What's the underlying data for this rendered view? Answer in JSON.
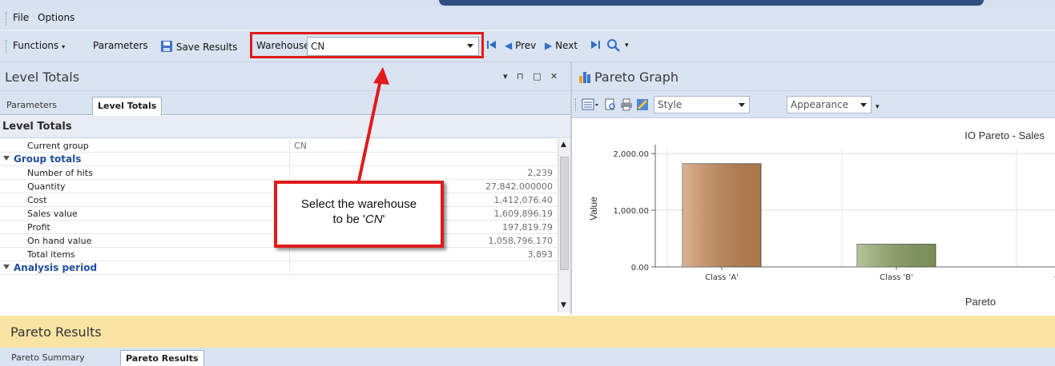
{
  "menu": {
    "file": "File",
    "options": "Options"
  },
  "toolbar": {
    "functions": "Functions",
    "parameters": "Parameters",
    "save_results": "Save Results",
    "warehouse_label": "Warehouse:",
    "warehouse_value": "CN",
    "prev": "Prev",
    "next": "Next"
  },
  "level_totals_panel": {
    "title": "Level Totals",
    "tabs": [
      "Parameters",
      "Level Totals"
    ],
    "active_tab": "Level Totals",
    "section_title": "Level Totals",
    "rows": [
      {
        "label": "Current group",
        "value": "CN"
      },
      {
        "label": "Group totals",
        "value": ""
      },
      {
        "label": "Number of hits",
        "value": "2,239"
      },
      {
        "label": "Quantity",
        "value": "27,842.000000"
      },
      {
        "label": "Cost",
        "value": "1,412,076.40"
      },
      {
        "label": "Sales value",
        "value": "1,609,896.19"
      },
      {
        "label": "Profit",
        "value": "197,819.79"
      },
      {
        "label": "On hand value",
        "value": "1,058,796.170"
      },
      {
        "label": "Total items",
        "value": "3,893"
      },
      {
        "label": "Analysis period",
        "value": ""
      }
    ]
  },
  "callout": {
    "line1": "Select the warehouse",
    "line2_prefix": "to be '",
    "line2_value": "CN",
    "line2_suffix": "'"
  },
  "pareto_graph_panel": {
    "title": "Pareto Graph",
    "style_label": "Style",
    "appearance_label": "Appearance"
  },
  "chart_data": {
    "type": "bar",
    "title": "IO Pareto - Sales",
    "xlabel": "Pareto",
    "ylabel": "Value",
    "categories": [
      "Class 'A'",
      "Class 'B'",
      "Class 'C'"
    ],
    "values": [
      1820,
      400,
      0
    ],
    "ylim": [
      0,
      2100
    ],
    "yticks": [
      0,
      1000,
      2000
    ],
    "ytick_labels": [
      "0.00",
      "1,000.00",
      "2,000.00"
    ],
    "grid": true,
    "colors": [
      "#c98a55",
      "#8fa766",
      "#bbbbbb"
    ]
  },
  "pareto_results_panel": {
    "title": "Pareto Results",
    "tabs": [
      "Pareto Summary",
      "Pareto Results"
    ],
    "active_tab": "Pareto Results"
  },
  "colors": {
    "highlight": "#e01b1b",
    "chrome": "#d9e3f2",
    "results_header": "#f9e4a4"
  }
}
